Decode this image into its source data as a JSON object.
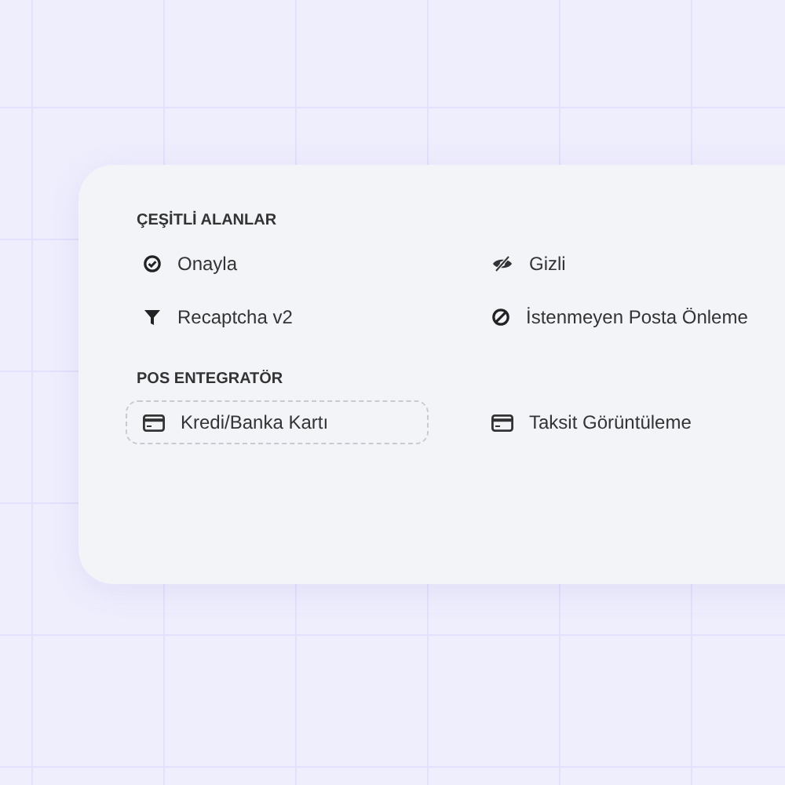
{
  "sections": [
    {
      "title": "ÇEŞİTLİ ALANLAR",
      "items": [
        {
          "label": "Onayla",
          "selected": false
        },
        {
          "label": "Gizli",
          "selected": false
        },
        {
          "label": "Recaptcha v2",
          "selected": false
        },
        {
          "label": "İstenmeyen Posta Önleme",
          "selected": false
        }
      ]
    },
    {
      "title": "POS ENTEGRATÖR",
      "items": [
        {
          "label": "Kredi/Banka Kartı",
          "selected": true
        },
        {
          "label": "Taksit Görüntüleme",
          "selected": false
        }
      ]
    }
  ]
}
